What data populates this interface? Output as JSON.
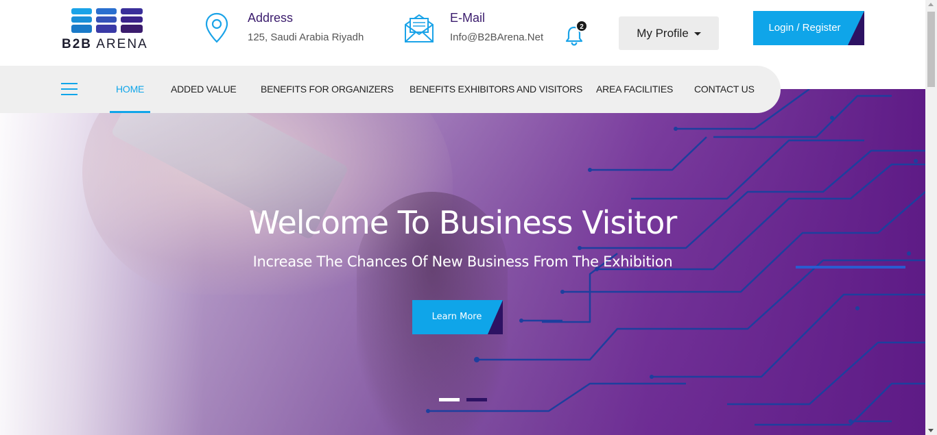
{
  "header": {
    "logo": {
      "brand_bold": "B2B",
      "brand_light": "ARENA"
    },
    "address": {
      "title": "Address",
      "value": "125, Saudi Arabia Riyadh",
      "icon": "map-pin-icon"
    },
    "email": {
      "title": "E-Mail",
      "value": "Info@B2BArena.Net",
      "icon": "envelope-icon"
    },
    "notifications": {
      "icon": "bell-icon",
      "count": "2"
    },
    "profile_label": "My Profile",
    "login_label": "Login / Register"
  },
  "nav": {
    "items": [
      {
        "label": "HOME",
        "active": true
      },
      {
        "label": "ADDED VALUE"
      },
      {
        "label": "BENEFITS FOR ORGANIZERS"
      },
      {
        "label": "BENEFITS EXHIBITORS AND VISITORS"
      },
      {
        "label": "AREA FACILITIES"
      },
      {
        "label": "CONTACT US"
      }
    ]
  },
  "hero": {
    "title": "Welcome To Business Visitor",
    "subtitle": "Increase The Chances Of New Business From The Exhibition",
    "button_label": "Learn More",
    "slides_total": 2,
    "active_slide": 1
  },
  "colors": {
    "accent": "#0fa5e9",
    "brand_dark": "#2d1263",
    "hero_purple": "#5e1b86",
    "nav_bg": "#efefef"
  }
}
